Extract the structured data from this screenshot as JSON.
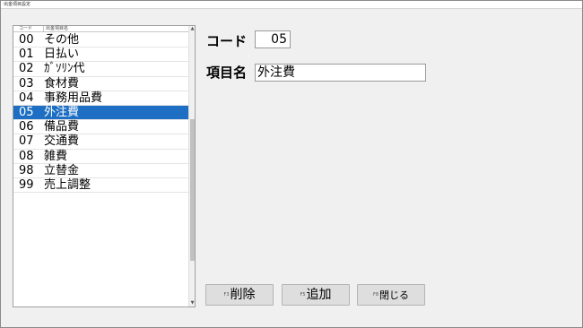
{
  "window": {
    "title": "出金項目設定"
  },
  "list": {
    "headers": {
      "code": "コード",
      "name": "出金項目名"
    },
    "rows": [
      {
        "code": "00",
        "name": "その他"
      },
      {
        "code": "01",
        "name": "日払い"
      },
      {
        "code": "02",
        "name": "ｶﾞｿﾘﾝ代"
      },
      {
        "code": "03",
        "name": "食材費"
      },
      {
        "code": "04",
        "name": "事務用品費"
      },
      {
        "code": "05",
        "name": "外注費"
      },
      {
        "code": "06",
        "name": "備品費"
      },
      {
        "code": "07",
        "name": "交通費"
      },
      {
        "code": "08",
        "name": "雑費"
      },
      {
        "code": "98",
        "name": "立替金"
      },
      {
        "code": "99",
        "name": "売上調整"
      }
    ],
    "selected_code": "05",
    "scroll_up": "▲",
    "scroll_down": "▼"
  },
  "form": {
    "code_label": "コード",
    "code_value": "05",
    "name_label": "項目名",
    "name_value": "外注費"
  },
  "buttons": {
    "delete": {
      "key": "F3",
      "label": "削除"
    },
    "add": {
      "key": "F5",
      "label": "追加"
    },
    "close": {
      "key": "F8",
      "label": "閉じる"
    }
  },
  "colors": {
    "selection": "#1e6fc4",
    "window_bg": "#f0f0f0"
  }
}
